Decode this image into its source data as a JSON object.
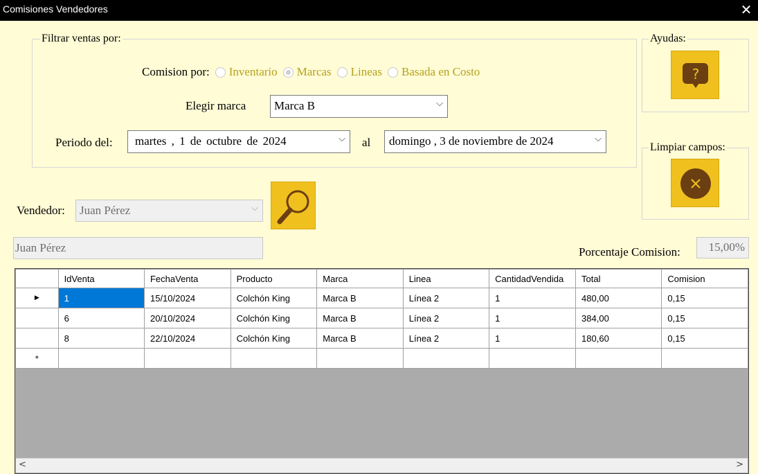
{
  "window": {
    "title": "Comisiones Vendedores",
    "close_glyph": "✕"
  },
  "filter": {
    "legend": "Filtrar ventas por:",
    "comision_label": "Comision por:",
    "options": [
      "Inventario",
      "Marcas",
      "Lineas",
      "Basada en Costo"
    ],
    "selected_option": "Marcas",
    "marca_label": "Elegir marca",
    "marca_value": "Marca B",
    "periodo_label": "Periodo del:",
    "date_from": "martes , 1 de octubre de 2024",
    "al_label": "al",
    "date_to": "domingo , 3 de noviembre de 2024"
  },
  "help": {
    "legend": "Ayudas:",
    "icon": "help-bubble-icon"
  },
  "clear": {
    "legend": "Limpiar campos:",
    "icon": "clear-x-icon"
  },
  "vendedor": {
    "label": "Vendedor:",
    "value": "Juan Pérez",
    "name_box": "Juan Pérez"
  },
  "search": {
    "icon": "magnifier-icon"
  },
  "porcentaje": {
    "label": "Porcentaje Comision:",
    "value": "15,00%"
  },
  "grid": {
    "columns": [
      "IdVenta",
      "FechaVenta",
      "Producto",
      "Marca",
      "Linea",
      "CantidadVendida",
      "Total",
      "Comision"
    ],
    "rows": [
      [
        "1",
        "15/10/2024",
        "Colchón King",
        "Marca B",
        "Línea 2",
        "1",
        "480,00",
        "0,15"
      ],
      [
        "6",
        "20/10/2024",
        "Colchón King",
        "Marca B",
        "Línea 2",
        "1",
        "384,00",
        "0,15"
      ],
      [
        "8",
        "22/10/2024",
        "Colchón King",
        "Marca B",
        "Línea 2",
        "1",
        "180,60",
        "0,15"
      ]
    ],
    "current_row_glyph": "▶",
    "new_row_glyph": "*"
  },
  "colors": {
    "background": "#fffcd6",
    "accent": "#f0c01f",
    "radio_text": "#b5a11c",
    "selection": "#0078d7"
  }
}
